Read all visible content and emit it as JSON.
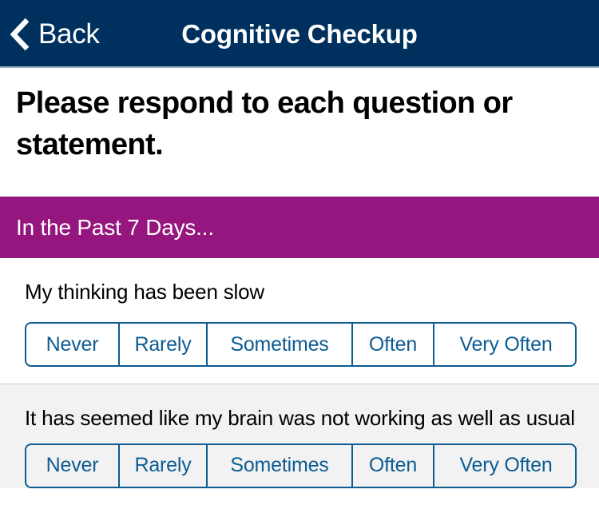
{
  "navbar": {
    "back_label": "Back",
    "back_icon": "chevron-left-icon",
    "title": "Cognitive Checkup",
    "background_color": "#00305E",
    "text_color": "#FFFFFF"
  },
  "instructions": {
    "text": "Please respond to each question or statement."
  },
  "section": {
    "label": "In the Past 7 Days...",
    "background_color": "#95167E",
    "text_color": "#FFFFFF"
  },
  "scale": {
    "accent_color": "#0D5C92",
    "options": [
      "Never",
      "Rarely",
      "Sometimes",
      "Often",
      "Very Often"
    ]
  },
  "questions": [
    {
      "text": "My thinking has been slow",
      "background": "#FFFFFF"
    },
    {
      "text": "It has seemed like my brain was not working as well as usual",
      "background": "#F2F2F2"
    }
  ]
}
